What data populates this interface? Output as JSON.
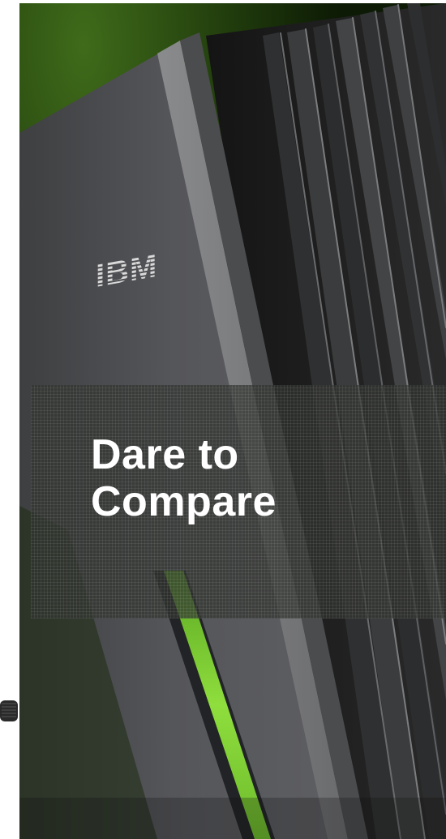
{
  "headline": {
    "line1": "Dare to",
    "line2": "Compare"
  },
  "logo": {
    "text": "IBM"
  },
  "colors": {
    "accent_green": "#7ec832",
    "panel_gray": "#4a4b4d",
    "banner_overlay": "#323430"
  }
}
